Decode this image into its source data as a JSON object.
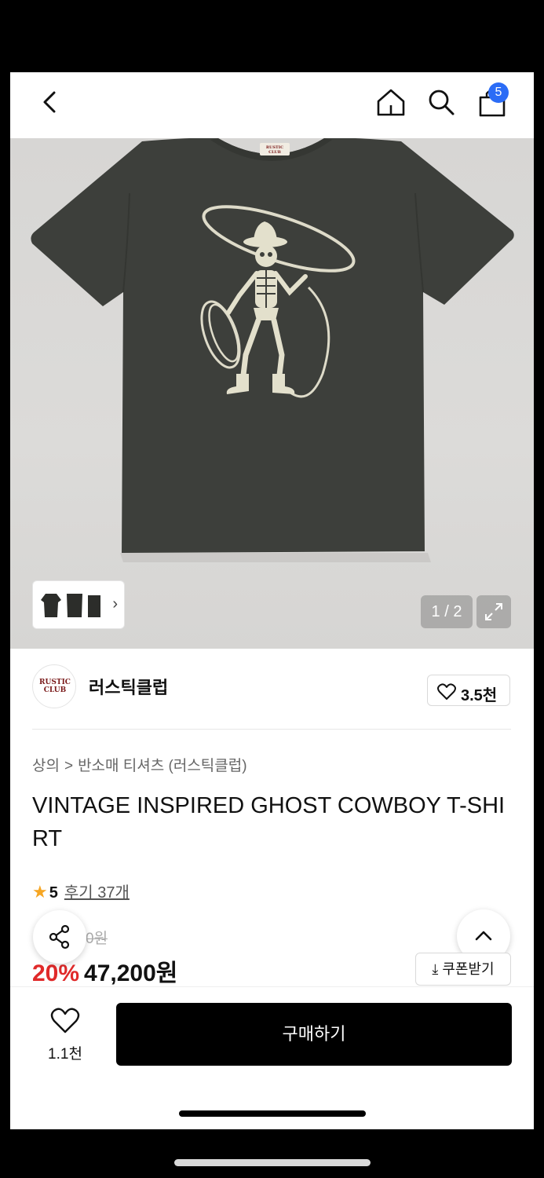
{
  "header": {
    "cart_count": "5"
  },
  "gallery": {
    "pager": "1 / 2",
    "thumb_arrow": "›",
    "print_label": "RUSTIC CLUB"
  },
  "brand": {
    "logo_text": "RUSTIC CLUB",
    "name": "러스틱클럽",
    "like_count": "3.5천"
  },
  "breadcrumb": {
    "category": "상의",
    "separator": ">",
    "subcategory": "반소매 티셔츠 (러스틱클럽)"
  },
  "product": {
    "title": "VINTAGE INSPIRED GHOST COWBOY T-SHIRT",
    "rating": "5",
    "review_link": "후기 37개",
    "original_price_visible": "0원",
    "discount": "20%",
    "sale_price": "47,200원"
  },
  "actions": {
    "coupon": "⤓ 쿠폰받기",
    "favorite_count": "1.1천",
    "buy": "구매하기"
  },
  "colors": {
    "badge": "#2b6cf6",
    "discount": "#e02a2a",
    "star": "#f6a623",
    "shirt": "#3d3f3b"
  }
}
